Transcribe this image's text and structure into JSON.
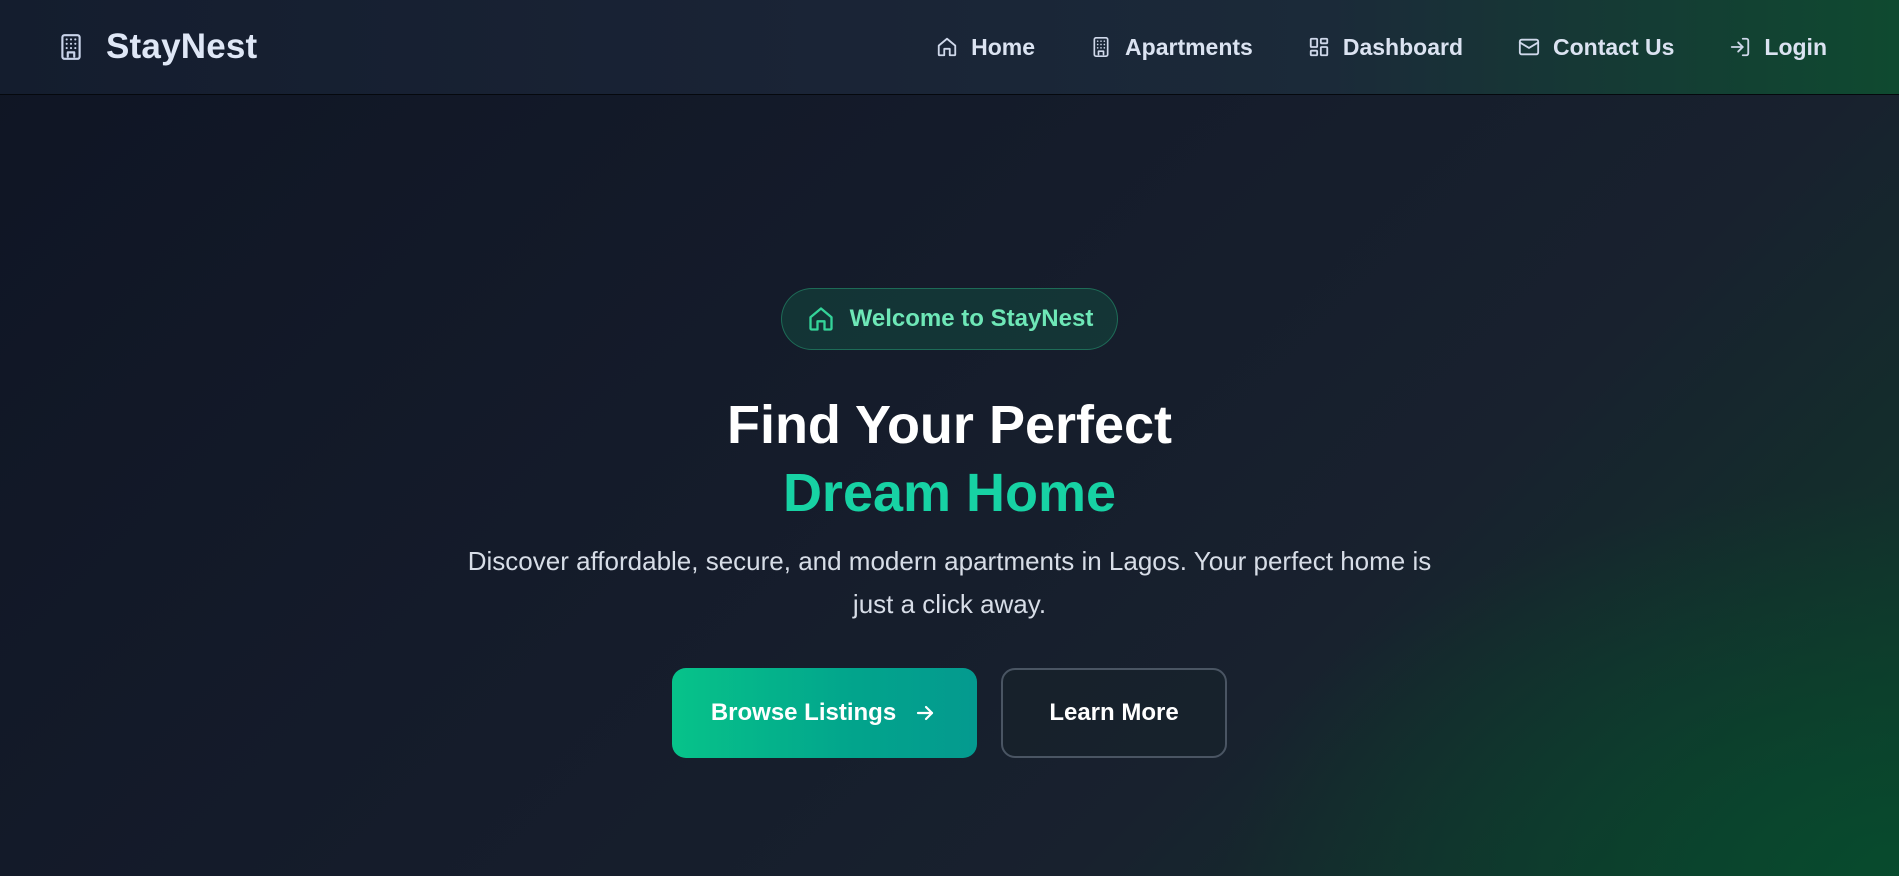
{
  "brand": {
    "name": "StayNest",
    "icon": "building-icon"
  },
  "nav": {
    "items": [
      {
        "label": "Home",
        "icon": "home-icon"
      },
      {
        "label": "Apartments",
        "icon": "building-icon"
      },
      {
        "label": "Dashboard",
        "icon": "dashboard-icon"
      },
      {
        "label": "Contact Us",
        "icon": "mail-icon"
      },
      {
        "label": "Login",
        "icon": "login-icon"
      }
    ]
  },
  "hero": {
    "badge": {
      "label": "Welcome to StayNest",
      "icon": "home-icon"
    },
    "headline": "Find Your Perfect",
    "headline_accent": "Dream Home",
    "subtitle": "Discover affordable, secure, and modern apartments in Lagos. Your perfect home is just a click away.",
    "primary_button": {
      "label": "Browse Listings",
      "icon": "arrow-right-icon"
    },
    "secondary_button": {
      "label": "Learn More"
    }
  },
  "colors": {
    "accent": "#17d2a4",
    "badge_text": "#6ee7b7",
    "primary_button_start": "#07c38a",
    "primary_button_end": "#049a8f",
    "background": "#151c2b"
  }
}
